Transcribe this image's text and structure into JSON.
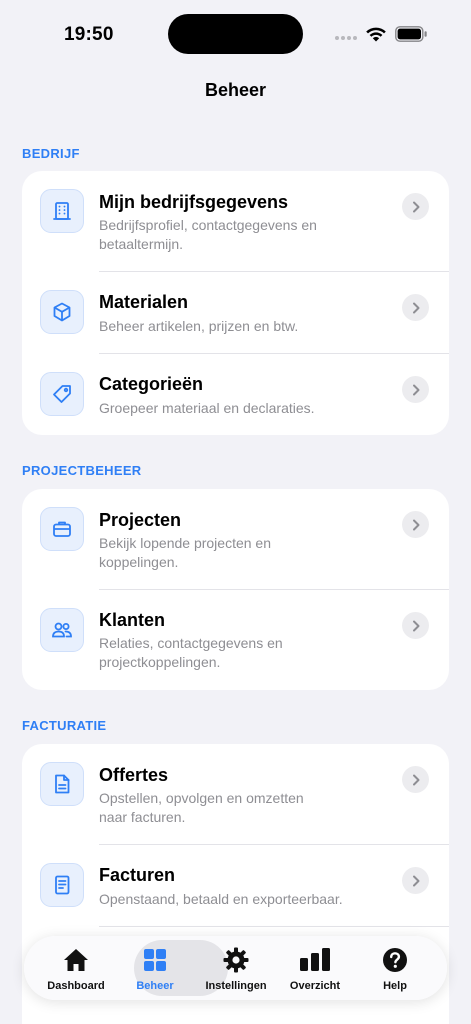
{
  "status": {
    "time": "19:50"
  },
  "nav": {
    "title": "Beheer"
  },
  "sections": [
    {
      "header": "BEDRIJF",
      "items": [
        {
          "title": "Mijn bedrijfsgegevens",
          "description": "Bedrijfsprofiel, contactgegevens en betaaltermijn.",
          "icon": "building-icon"
        },
        {
          "title": "Materialen",
          "description": "Beheer artikelen, prijzen en btw.",
          "icon": "box-icon"
        },
        {
          "title": "Categorieën",
          "description": "Groepeer materiaal en declaraties.",
          "icon": "tag-icon"
        }
      ]
    },
    {
      "header": "PROJECTBEHEER",
      "items": [
        {
          "title": "Projecten",
          "description": "Bekijk lopende projecten en koppelingen.",
          "icon": "briefcase-icon"
        },
        {
          "title": "Klanten",
          "description": "Relaties, contactgegevens en projectkoppelingen.",
          "icon": "people-icon"
        }
      ]
    },
    {
      "header": "FACTURATIE",
      "items": [
        {
          "title": "Offertes",
          "description": "Opstellen, opvolgen en omzetten naar facturen.",
          "icon": "document-icon"
        },
        {
          "title": "Facturen",
          "description": "Openstaand, betaald en exporteerbaar.",
          "icon": "invoice-icon"
        }
      ]
    }
  ],
  "tabs": [
    {
      "label": "Dashboard",
      "icon": "house-icon",
      "active": false
    },
    {
      "label": "Beheer",
      "icon": "grid-icon",
      "active": true
    },
    {
      "label": "Instellingen",
      "icon": "gear-icon",
      "active": false
    },
    {
      "label": "Overzicht",
      "icon": "bar-chart-icon",
      "active": false
    },
    {
      "label": "Help",
      "icon": "question-icon",
      "active": false
    }
  ],
  "colors": {
    "accent": "#2f7ff5",
    "background": "#f2f2f7",
    "icon_bg": "#e8f0fd",
    "secondary_text": "#8e8e93"
  }
}
